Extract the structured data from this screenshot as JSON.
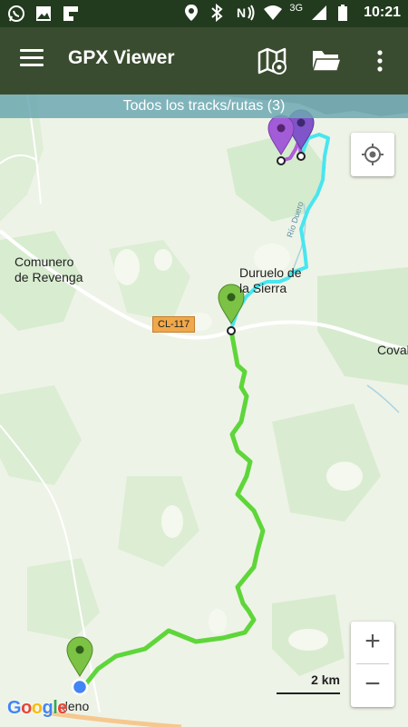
{
  "status_bar": {
    "time": "10:21",
    "network": "3G",
    "icons": [
      "whatsapp-icon",
      "image-icon",
      "flipboard-icon",
      "location-icon",
      "bluetooth-icon",
      "nfc-icon",
      "wifi-icon",
      "signal-icon",
      "battery-icon"
    ]
  },
  "app_bar": {
    "title": "GPX Viewer",
    "actions": [
      "menu-icon",
      "map-layers-icon",
      "folder-icon",
      "more-vert-icon"
    ]
  },
  "banner": {
    "text": "Todos los tracks/rutas (3)"
  },
  "map": {
    "place_labels": {
      "comunero": "Comunero\nde Revenga",
      "duruelo": "Duruelo de\nla Sierra",
      "coval": "Coval",
      "river": "Río Duero",
      "town_bottom": "aleno"
    },
    "road_badge": "CL-117",
    "scale_text": "2 km",
    "zoom_in": "+",
    "zoom_out": "−",
    "attribution": "Google"
  },
  "colors": {
    "status_bar": "#223b1e",
    "app_bar": "#3a4c2f",
    "banner": "#6ca8b2",
    "track_green": "#5ed63a",
    "track_cyan": "#48e6ef",
    "track_purple": "#b05bd9",
    "marker_green": "#7cc245",
    "marker_purple": "#a35cd8"
  }
}
